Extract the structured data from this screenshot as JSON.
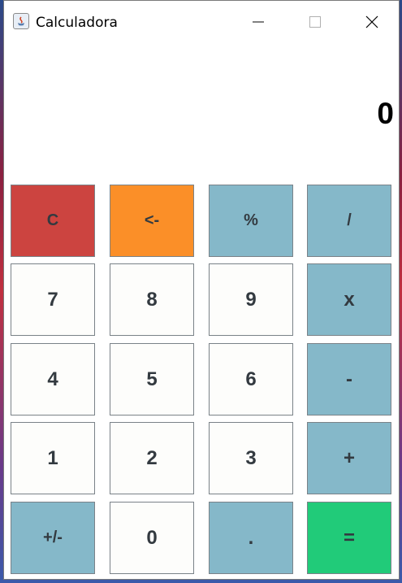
{
  "window": {
    "title": "Calculadora",
    "icon": "java-icon"
  },
  "display": {
    "value": "0"
  },
  "keys": {
    "clear": "C",
    "backspace": "<-",
    "percent": "%",
    "divide": "/",
    "seven": "7",
    "eight": "8",
    "nine": "9",
    "multiply": "x",
    "four": "4",
    "five": "5",
    "six": "6",
    "subtract": "-",
    "one": "1",
    "two": "2",
    "three": "3",
    "add": "+",
    "negate": "+/-",
    "zero": "0",
    "decimal": ".",
    "equals": "="
  },
  "colors": {
    "clear": "#cc4440",
    "backspace": "#fb8f28",
    "operator": "#85b8c9",
    "digit": "#fdfdfb",
    "equals": "#21cb79"
  }
}
